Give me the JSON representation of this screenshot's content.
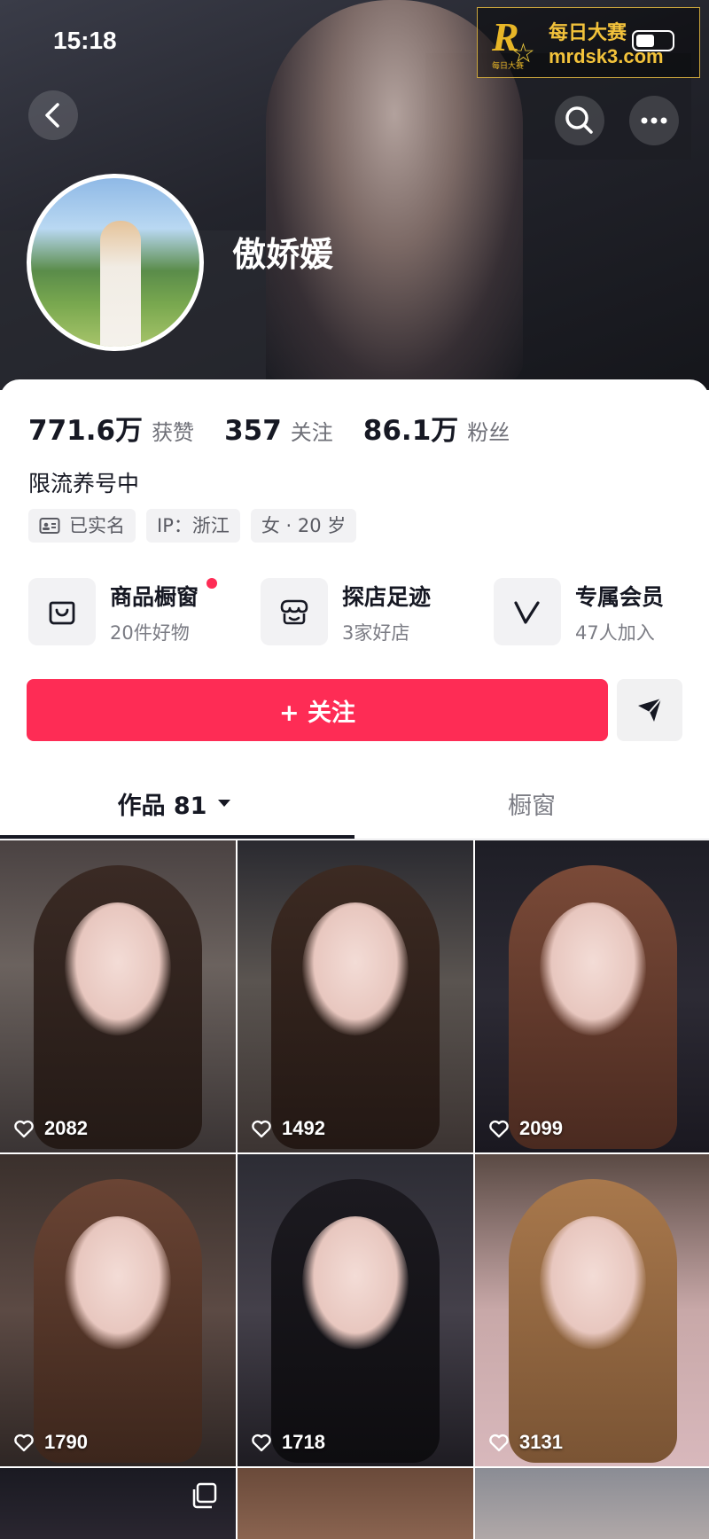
{
  "status_bar": {
    "time": "15:18"
  },
  "watermark": {
    "letter": "R",
    "small": "每日大赛",
    "cn": "每日大赛",
    "url": "mrdsk3.com"
  },
  "profile": {
    "name": "傲娇媛",
    "bio": "限流养号中"
  },
  "stats": [
    {
      "value": "771.6万",
      "label": "获赞"
    },
    {
      "value": "357",
      "label": "关注"
    },
    {
      "value": "86.1万",
      "label": "粉丝"
    }
  ],
  "tags": [
    {
      "icon": "id-card-icon",
      "label": "已实名"
    },
    {
      "label": "IP：浙江"
    },
    {
      "label": "女 · 20 岁"
    }
  ],
  "features": [
    {
      "icon": "shopping-bag-icon",
      "title": "商品橱窗",
      "subtitle": "20件好物"
    },
    {
      "icon": "store-icon",
      "title": "探店足迹",
      "subtitle": "3家好店"
    },
    {
      "icon": "membership-v-icon",
      "title": "专属会员",
      "subtitle": "47人加入"
    }
  ],
  "follow_button": {
    "label": "+ 关注"
  },
  "tabs": [
    {
      "label": "作品 81",
      "active": true
    },
    {
      "label": "橱窗",
      "active": false
    }
  ],
  "videos": [
    {
      "likes": "2082"
    },
    {
      "likes": "1492"
    },
    {
      "likes": "2099"
    },
    {
      "likes": "1790"
    },
    {
      "likes": "1718"
    },
    {
      "likes": "3131"
    }
  ],
  "colors": {
    "accent": "#fe2c55",
    "text": "#161823",
    "muted": "#7b7c84"
  }
}
